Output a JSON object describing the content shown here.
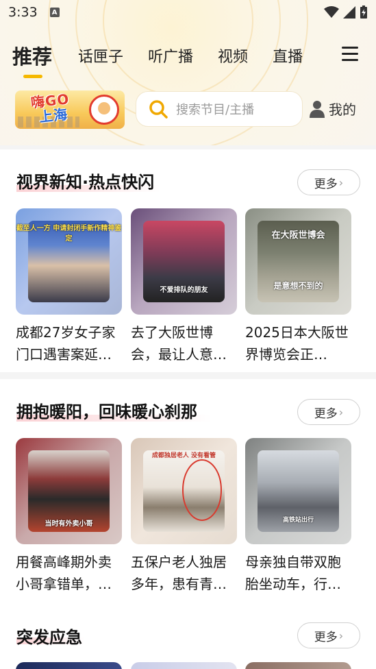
{
  "status": {
    "time": "3:33",
    "notif": "A"
  },
  "nav": {
    "tabs": [
      {
        "label": "推荐",
        "active": true
      },
      {
        "label": "话匣子"
      },
      {
        "label": "听广播"
      },
      {
        "label": "视频"
      },
      {
        "label": "直播"
      }
    ]
  },
  "banner": {
    "logo_line1": "嗨GO",
    "logo_line2": "上海",
    "search_placeholder": "搜索节目/主播",
    "mine_label": "我的"
  },
  "sections": [
    {
      "title": "视界新知·热点快闪",
      "more": "更多",
      "cards": [
        {
          "title": "成都27岁女子家门口遇害案延…",
          "caption_top": "截至人一方 申请封闭手新作精神鉴定",
          "caption_bottom": ""
        },
        {
          "title": "去了大阪世博会，最让人意…",
          "caption_top": "",
          "caption_bottom": "不爱排队的朋友"
        },
        {
          "title": "2025日本大阪世界博览会正…",
          "caption_top": "在大阪世博会",
          "caption_bottom": "是意想不到的"
        }
      ]
    },
    {
      "title": "拥抱暖阳，回味暖心刹那",
      "more": "更多",
      "cards": [
        {
          "title": "用餐高峰期外卖小哥拿错单，…",
          "caption_top": "",
          "caption_bottom": "当时有外卖小哥"
        },
        {
          "title": "五保户老人独居多年，患有青…",
          "caption_top": "成都独居老人 没有看管",
          "caption_bottom": ""
        },
        {
          "title": "母亲独自带双胞胎坐动车，行…",
          "caption_top": "",
          "caption_bottom": "高铁站出行"
        }
      ]
    },
    {
      "title": "突发应急",
      "more": "更多"
    }
  ],
  "colors": {
    "accent": "#f5b800",
    "title_highlight": "#fbd2d5",
    "search_icon": "#f0a800"
  },
  "icons": {
    "search": "search-icon",
    "user": "user-icon",
    "menu": "menu-icon",
    "chevron": "chevron-right-icon"
  }
}
